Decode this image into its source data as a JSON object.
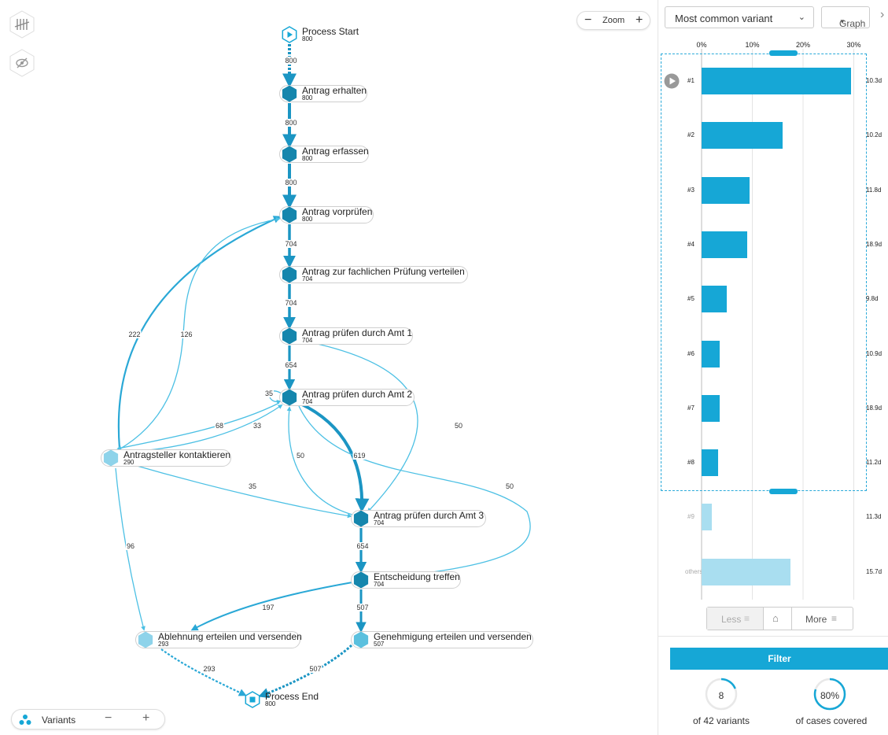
{
  "graph": {
    "zoom_label": "Zoom",
    "variants_label": "Variants",
    "nodes": [
      {
        "id": "start",
        "name": "Process Start",
        "count": "800",
        "type": "start"
      },
      {
        "id": "n1",
        "name": "Antrag erhalten",
        "count": "800",
        "type": "activity"
      },
      {
        "id": "n2",
        "name": "Antrag erfassen",
        "count": "800",
        "type": "activity"
      },
      {
        "id": "n3",
        "name": "Antrag vorprüfen",
        "count": "800",
        "type": "activity"
      },
      {
        "id": "n4",
        "name": "Antrag zur fachlichen Prüfung verteilen",
        "count": "704",
        "type": "activity"
      },
      {
        "id": "n5",
        "name": "Antrag prüfen durch Amt 1",
        "count": "704",
        "type": "activity"
      },
      {
        "id": "n6",
        "name": "Antrag prüfen durch Amt 2",
        "count": "704",
        "type": "activity"
      },
      {
        "id": "n7",
        "name": "Antragsteller kontaktieren",
        "count": "290",
        "type": "activity-light"
      },
      {
        "id": "n8",
        "name": "Antrag prüfen durch Amt 3",
        "count": "704",
        "type": "activity"
      },
      {
        "id": "n9",
        "name": "Entscheidung treffen",
        "count": "704",
        "type": "activity"
      },
      {
        "id": "n10",
        "name": "Ablehnung erteilen und versenden",
        "count": "293",
        "type": "activity-light"
      },
      {
        "id": "n11",
        "name": "Genehmigung erteilen und versenden",
        "count": "507",
        "type": "activity-mid"
      },
      {
        "id": "end",
        "name": "Process End",
        "count": "800",
        "type": "end"
      }
    ],
    "edges": [
      {
        "label": "800"
      },
      {
        "label": "800"
      },
      {
        "label": "800"
      },
      {
        "label": "704"
      },
      {
        "label": "704"
      },
      {
        "label": "654"
      },
      {
        "label": "35"
      },
      {
        "label": "222"
      },
      {
        "label": "126"
      },
      {
        "label": "68"
      },
      {
        "label": "33"
      },
      {
        "label": "50"
      },
      {
        "label": "619"
      },
      {
        "label": "50"
      },
      {
        "label": "35"
      },
      {
        "label": "50"
      },
      {
        "label": "654"
      },
      {
        "label": "96"
      },
      {
        "label": "197"
      },
      {
        "label": "507"
      },
      {
        "label": "293"
      },
      {
        "label": "507"
      }
    ]
  },
  "panel": {
    "variant_select": "Most common variant",
    "view_button": "Graph",
    "axis_ticks": [
      "0%",
      "10%",
      "20%",
      "30%"
    ],
    "variants": [
      {
        "label": "#1",
        "share": 29.5,
        "duration": "10.3d",
        "selected": true
      },
      {
        "label": "#2",
        "share": 16.0,
        "duration": "10.2d",
        "selected": true
      },
      {
        "label": "#3",
        "share": 9.5,
        "duration": "11.8d",
        "selected": true
      },
      {
        "label": "#4",
        "share": 9.0,
        "duration": "18.9d",
        "selected": true
      },
      {
        "label": "#5",
        "share": 5.0,
        "duration": "9.8d",
        "selected": true
      },
      {
        "label": "#6",
        "share": 3.5,
        "duration": "10.9d",
        "selected": true
      },
      {
        "label": "#7",
        "share": 3.5,
        "duration": "18.9d",
        "selected": true
      },
      {
        "label": "#8",
        "share": 3.3,
        "duration": "11.2d",
        "selected": true
      },
      {
        "label": "#9",
        "share": 2.0,
        "duration": "11.3d",
        "selected": false
      },
      {
        "label": "others",
        "share": 17.5,
        "duration": "15.7d",
        "selected": false
      }
    ],
    "less_label": "Less",
    "more_label": "More",
    "filter_label": "Filter",
    "variants_count": "8",
    "variants_caption": "of 42 variants",
    "cases_pct": "80%",
    "cases_fraction": 0.8,
    "variants_fraction": 0.19,
    "cases_caption": "of cases covered"
  },
  "colors": {
    "accent": "#16a7d6",
    "node_dark": "#1586ad",
    "node_light": "#8ed3ea",
    "edge_light": "#4cc0e4"
  }
}
